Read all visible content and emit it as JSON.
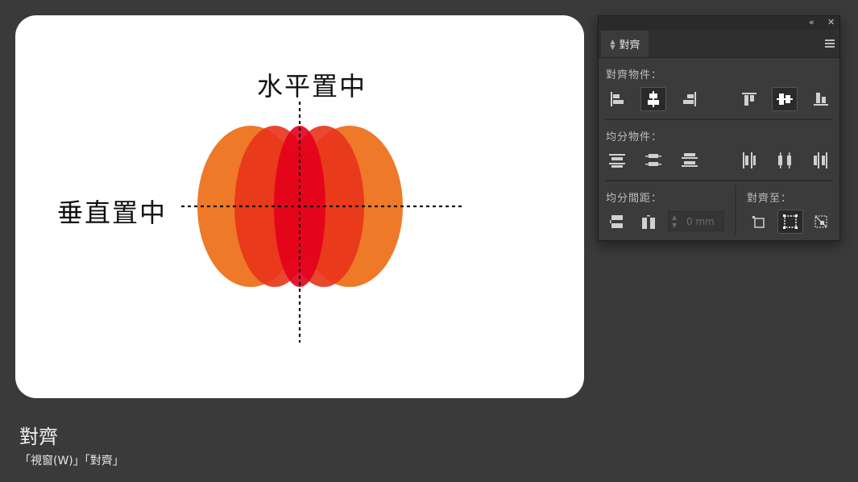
{
  "canvas": {
    "horizontal_center_label": "水平置中",
    "vertical_center_label": "垂直置中",
    "ellipse_colors": [
      "#ec6a12",
      "#e8331a",
      "#e4001c"
    ]
  },
  "caption": {
    "title": "對齊",
    "menu_path": "「視窗(W)」「對齊」"
  },
  "panel": {
    "collapse_glyph": "«",
    "close_glyph": "✕",
    "tab_label": "對齊",
    "align_objects_label": "對齊物件：",
    "distribute_objects_label": "均分物件：",
    "distribute_spacing_label": "均分間距：",
    "align_to_label": "對齊至：",
    "spacing_value": "0 mm",
    "active_buttons": [
      "horizontal-align-center",
      "vertical-align-center",
      "align-to-key-object"
    ]
  }
}
